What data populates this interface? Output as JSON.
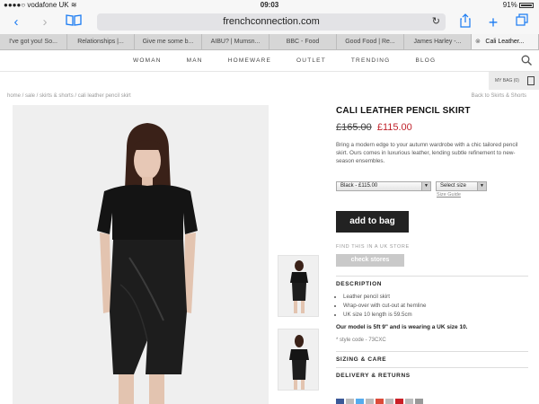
{
  "status_bar": {
    "carrier": "vodafone UK",
    "time": "09:03",
    "battery": "91%"
  },
  "browser": {
    "url": "frenchconnection.com",
    "tabs": [
      "I've got you! So...",
      "Relationships |...",
      "Give me some b...",
      "AIBU? | Mumsn...",
      "BBC - Food",
      "Good Food | Re...",
      "James Harley -...",
      "Cali Leather..."
    ],
    "active_tab_index": 7
  },
  "site_nav": {
    "items": [
      "WOMAN",
      "MAN",
      "HOMEWARE",
      "OUTLET",
      "TRENDING",
      "BLOG"
    ]
  },
  "my_bag": "MY BAG (0)",
  "breadcrumb": "home / sale / skirts & shorts / cali leather pencil skirt",
  "back_link": "Back to Skirts & Shorts",
  "product": {
    "title": "CALI LEATHER PENCIL SKIRT",
    "old_price": "£165.00",
    "new_price": "£115.00",
    "description": "Bring a modern edge to your autumn wardrobe with a chic tailored pencil skirt. Ours comes in luxurious leather, lending subtle refinement to new-season ensembles.",
    "colour_select": "Black - £115.00",
    "size_select": "Select size",
    "size_guide": "Size Guide",
    "add_to_bag": "add to bag",
    "find_in_store": "FIND THIS IN A UK STORE",
    "check_stores": "check stores",
    "description_heading": "DESCRIPTION",
    "bullets": [
      "Leather pencil skirt",
      "Wrap-over with cut-out at hemline",
      "UK size 10 length is 59.5cm"
    ],
    "model_note": "Our model is 5ft 9\" and is wearing a UK size 10.",
    "style_code": "* style code - 73CXC",
    "sizing_heading": "SIZING & CARE",
    "delivery_heading": "DELIVERY & RETURNS"
  },
  "colors": {
    "sale_red": "#c0232c",
    "ios_blue": "#1a7bf2",
    "button_dark": "#222222"
  }
}
